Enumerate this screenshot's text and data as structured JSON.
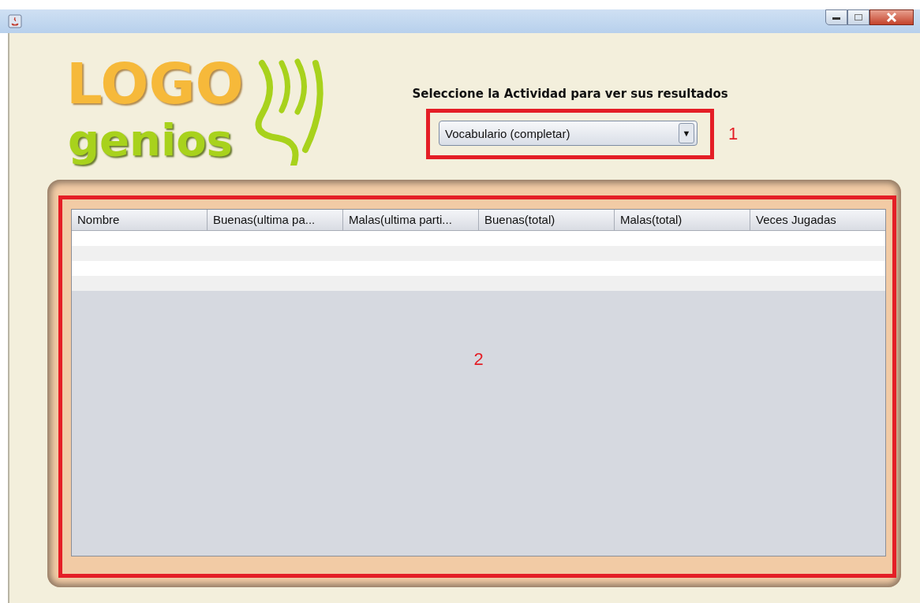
{
  "logo": {
    "top": "LOGO",
    "bottom": "genios"
  },
  "prompt": "Seleccione la Actividad para ver sus resultados",
  "activity_select": {
    "value": "Vocabulario (completar)",
    "caret": "▼",
    "annotation": "1"
  },
  "table": {
    "columns": [
      "Nombre",
      "Buenas(ultima pa...",
      "Malas(ultima parti...",
      "Buenas(total)",
      "Malas(total)",
      "Veces Jugadas"
    ],
    "annotation": "2"
  }
}
